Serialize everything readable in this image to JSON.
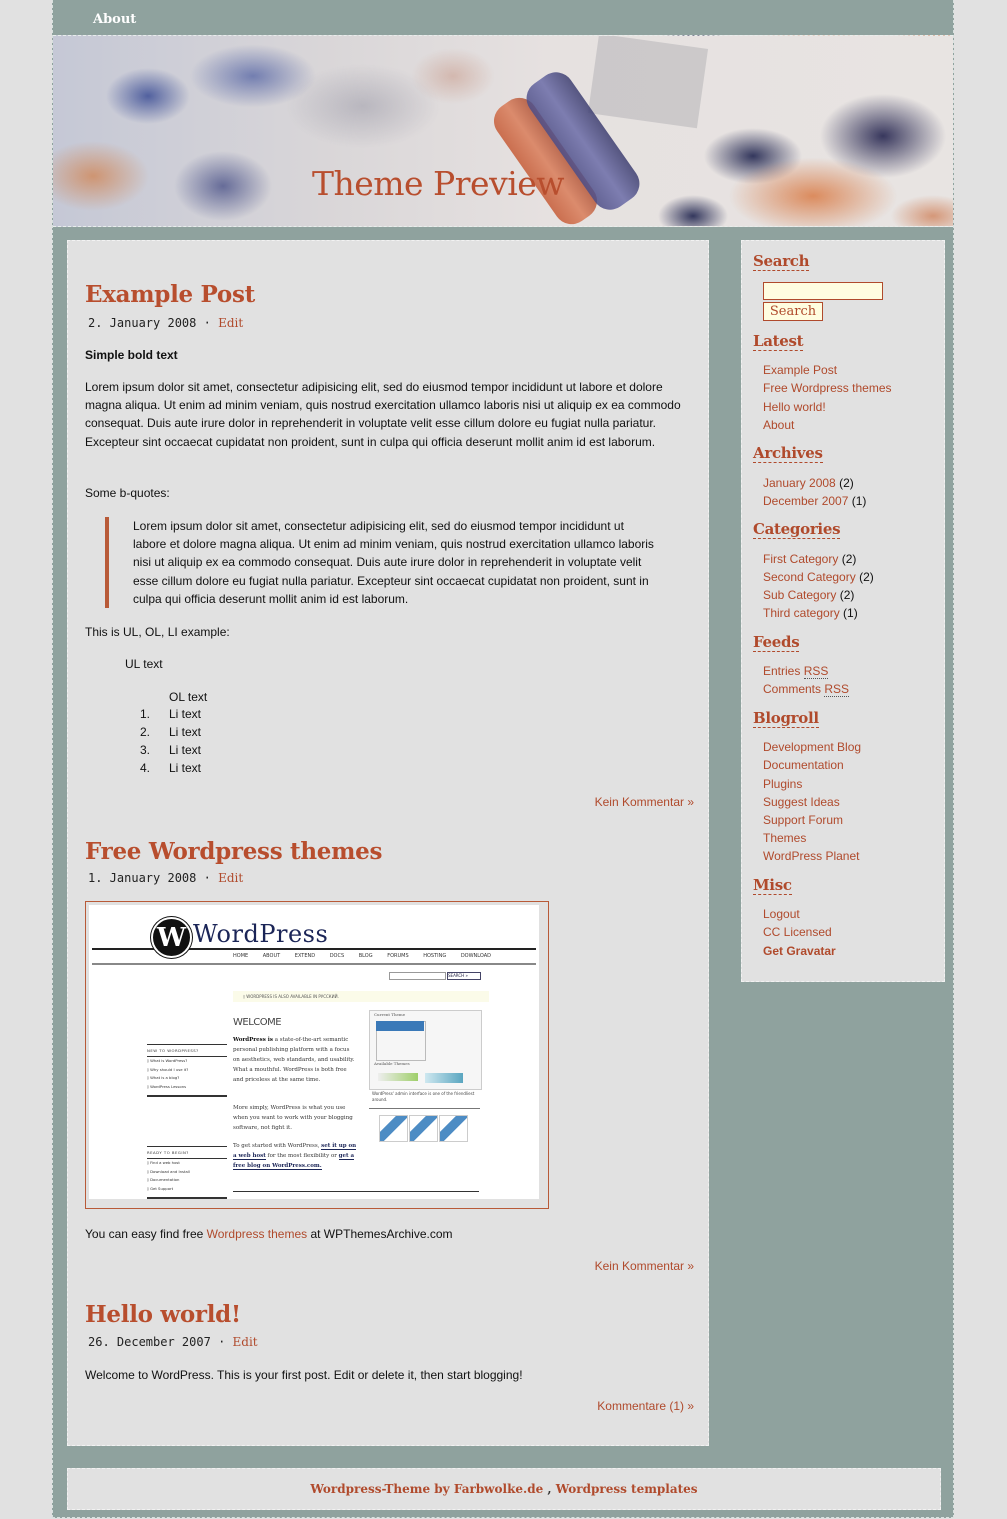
{
  "nav": {
    "about_label": "About"
  },
  "header": {
    "site_title": "Theme Preview"
  },
  "posts": [
    {
      "title": "Example Post",
      "date": "2. January 2008",
      "separator": "·",
      "edit_label": "Edit",
      "bold_text": "Simple bold text",
      "paragraph": "Lorem ipsum dolor sit amet, consectetur adipisicing elit, sed do eiusmod tempor incididunt ut labore et dolore magna aliqua. Ut enim ad minim veniam, quis nostrud exercitation ullamco laboris nisi ut aliquip ex ea commodo consequat. Duis aute irure dolor in reprehenderit in voluptate velit esse cillum dolore eu fugiat nulla pariatur. Excepteur sint occaecat cupidatat non proident, sunt in culpa qui officia deserunt mollit anim id est laborum.",
      "bquote_intro": "Some b-quotes:",
      "blockquote": "Lorem ipsum dolor sit amet, consectetur adipisicing elit, sed do eiusmod tempor incididunt ut labore et dolore magna aliqua. Ut enim ad minim veniam, quis nostrud exercitation ullamco laboris nisi ut aliquip ex ea commodo consequat. Duis aute irure dolor in reprehenderit in voluptate velit esse cillum dolore eu fugiat nulla pariatur. Excepteur sint occaecat cupidatat non proident, sunt in culpa qui officia deserunt mollit anim id est laborum.",
      "list_intro": "This is UL, OL, LI example:",
      "ul_text": "UL text",
      "ol_text": "OL text",
      "ol_items": [
        "Li text",
        "Li text",
        "Li text",
        "Li text"
      ],
      "comments_label": "Kein Kommentar »"
    },
    {
      "title": "Free Wordpress themes",
      "date": "1. January 2008",
      "separator": "·",
      "edit_label": "Edit",
      "screenshot": {
        "logo_text": "WordPress",
        "nav_items": [
          "HOME",
          "ABOUT",
          "EXTEND",
          "DOCS",
          "BLOG",
          "FORUMS",
          "HOSTING",
          "DOWNLOAD"
        ],
        "search_button": "SEARCH »",
        "banner": "◊ WORDPRESS IS ALSO AVAILABLE IN РУССКИЙ.",
        "welcome": "WELCOME",
        "para1_bold": "WordPress is",
        "para1": " a state-of-the-art semantic personal publishing platform with a focus on aesthetics, web standards, and usability. What a mouthful. WordPress is both free and priceless at the same time.",
        "para2": "More simply, WordPress is what you use when you want to work with your blogging software, not fight it.",
        "para3_a": "To get started with WordPress, ",
        "para3_link1": "set it up on a web host",
        "para3_b": " for the most flexibility or ",
        "para3_link2": "get a free blog on WordPress.com.",
        "side1_heading": "NEW TO WORDPRESS?",
        "side1_items": [
          "◊ What is WordPress?",
          "◊ Why should I use it?",
          "◊ What is a blog?",
          "◊ WordPress Lessons"
        ],
        "side2_heading": "READY TO BEGIN?",
        "side2_items": [
          "◊ Find a web host",
          "◊ Download and Install",
          "◊ Documentation",
          "◊ Get Support"
        ],
        "panel_label1": "Current Theme",
        "panel_label2": "Available Themes",
        "caption": "WordPress' admin interface is one of the friendliest around."
      },
      "text_before": "You can easy find free ",
      "link_text": "Wordpress themes",
      "text_after": " at WPThemesArchive.com",
      "comments_label": "Kein Kommentar »"
    },
    {
      "title": "Hello world!",
      "date": "26. December 2007",
      "separator": "·",
      "edit_label": "Edit",
      "paragraph": "Welcome to WordPress. This is your first post. Edit or delete it, then start blogging!",
      "comments_label": "Kommentare (1) »"
    }
  ],
  "sidebar": {
    "search": {
      "heading": "Search",
      "input_value": "",
      "button_label": "Search"
    },
    "latest": {
      "heading": "Latest",
      "items": [
        "Example Post",
        "Free Wordpress themes",
        "Hello world!",
        "About"
      ]
    },
    "archives": {
      "heading": "Archives",
      "items": [
        {
          "label": "January 2008",
          "count": "(2)"
        },
        {
          "label": "December 2007",
          "count": "(1)"
        }
      ]
    },
    "categories": {
      "heading": "Categories",
      "items": [
        {
          "label": "First Category",
          "count": "(2)"
        },
        {
          "label": "Second Category",
          "count": "(2)"
        },
        {
          "label": "Sub Category",
          "count": "(2)"
        },
        {
          "label": "Third category",
          "count": "(1)"
        }
      ]
    },
    "feeds": {
      "heading": "Feeds",
      "items": [
        {
          "label": "Entries ",
          "abbr": "RSS"
        },
        {
          "label": "Comments ",
          "abbr": "RSS"
        }
      ]
    },
    "blogroll": {
      "heading": "Blogroll",
      "items": [
        "Development Blog",
        "Documentation",
        "Plugins",
        "Suggest Ideas",
        "Support Forum",
        "Themes",
        "WordPress Planet"
      ]
    },
    "misc": {
      "heading": "Misc",
      "items": [
        "Logout",
        "CC Licensed",
        "Get Gravatar"
      ]
    }
  },
  "footer": {
    "link1": "Wordpress-Theme by Farbwolke.de",
    "separator": " , ",
    "link2": "Wordpress templates"
  },
  "colors": {
    "accent": "#b04a2c",
    "page_bg": "#8fa29e",
    "content_bg": "#e1e1e1",
    "input_bg": "#fffde0"
  }
}
